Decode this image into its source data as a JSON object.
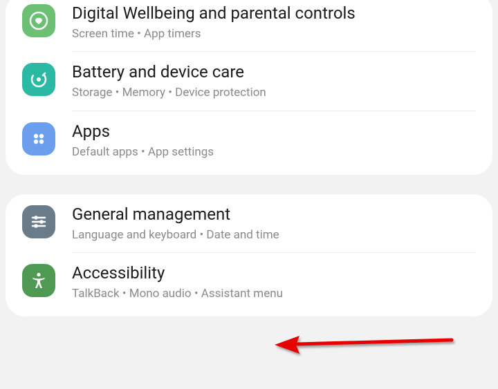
{
  "settings": {
    "groups": [
      {
        "items": [
          {
            "id": "digital-wellbeing",
            "title": "Digital Wellbeing and parental controls",
            "subtitle": "Screen time  •  App timers",
            "icon_bg": "#6cc073"
          },
          {
            "id": "battery-device-care",
            "title": "Battery and device care",
            "subtitle": "Storage  •  Memory  •  Device protection",
            "icon_bg": "#2bb9a3"
          },
          {
            "id": "apps",
            "title": "Apps",
            "subtitle": "Default apps  •  App settings",
            "icon_bg": "#6b9fee"
          }
        ]
      },
      {
        "items": [
          {
            "id": "general-management",
            "title": "General management",
            "subtitle": "Language and keyboard  •  Date and time",
            "icon_bg": "#6a7b8a"
          },
          {
            "id": "accessibility",
            "title": "Accessibility",
            "subtitle": "TalkBack  •  Mono audio  •  Assistant menu",
            "icon_bg": "#4f9a52"
          }
        ]
      }
    ]
  },
  "annotation": {
    "arrow_color": "#e60000"
  }
}
